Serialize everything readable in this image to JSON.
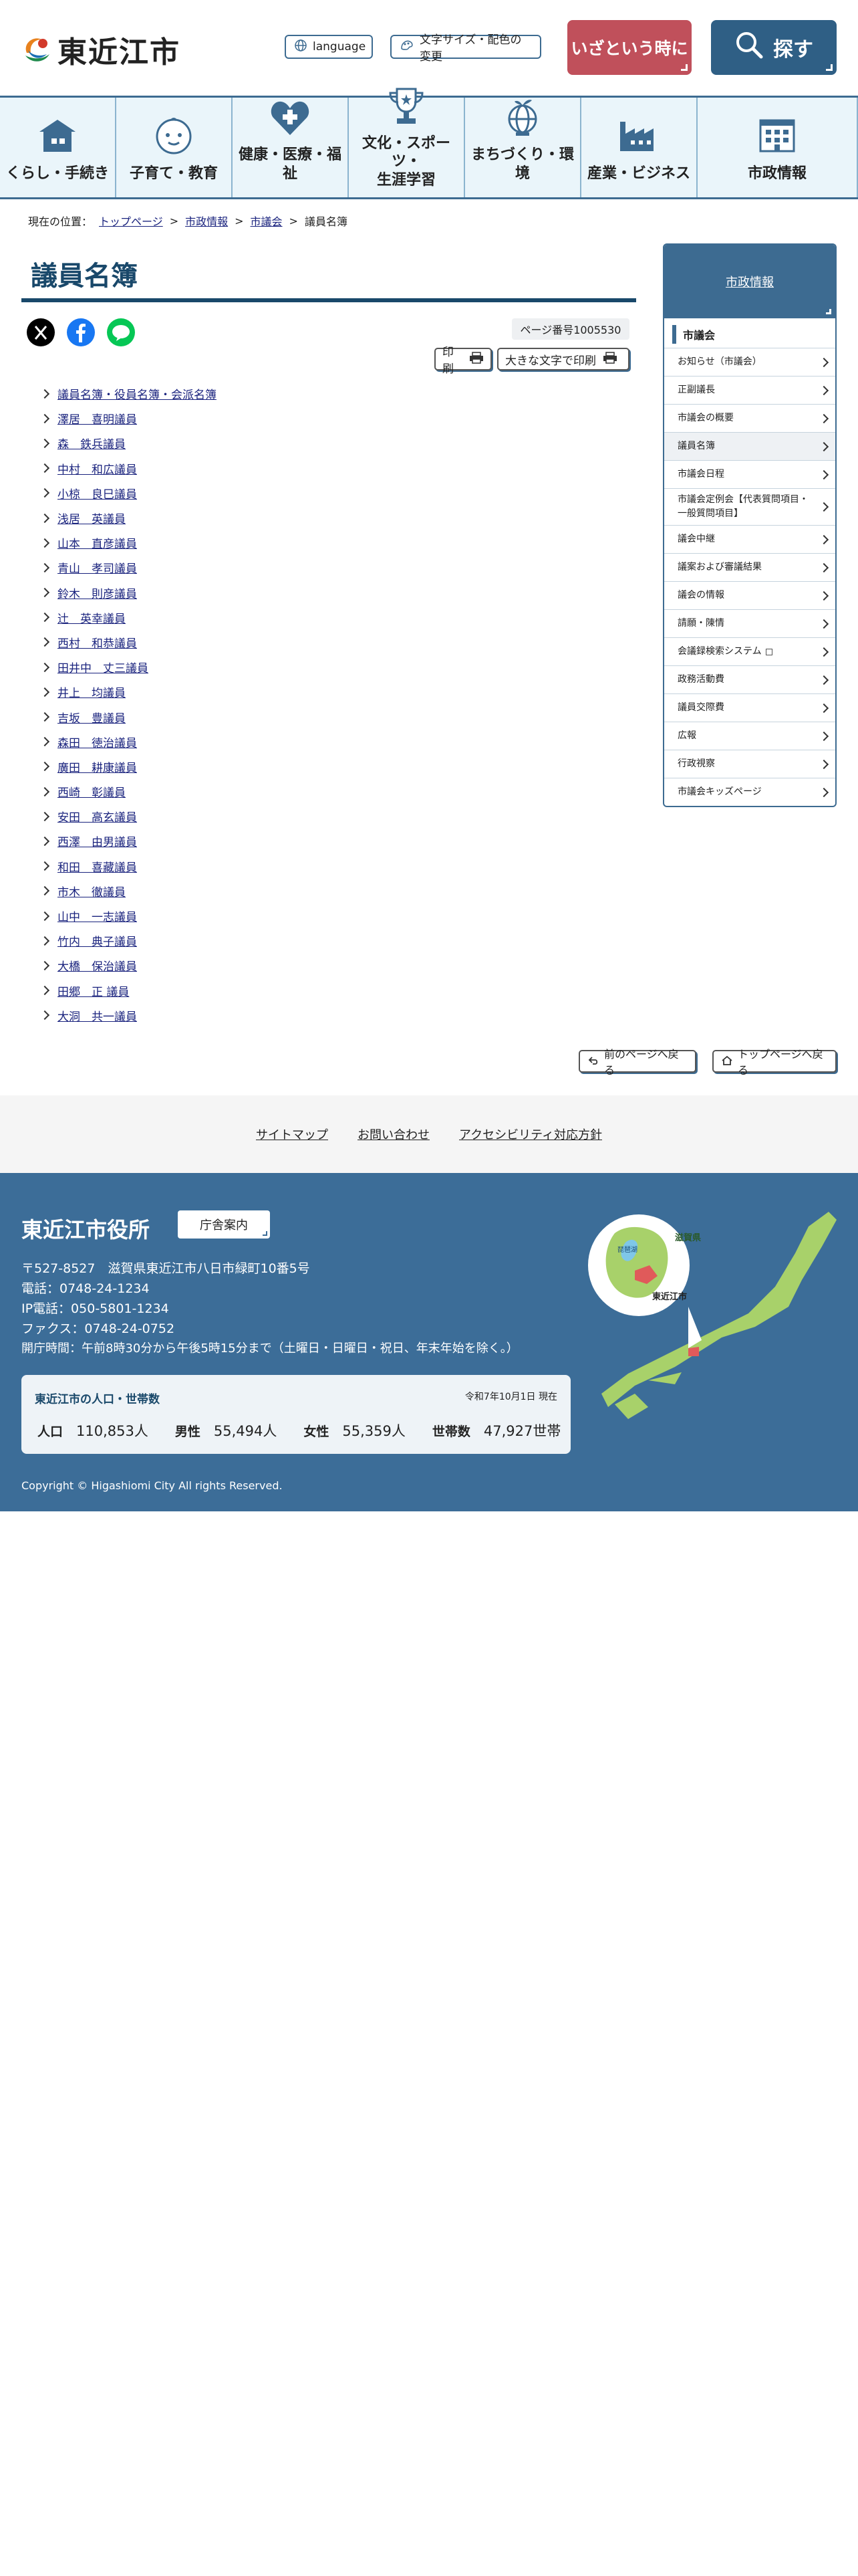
{
  "site": {
    "logo_text": "東近江市"
  },
  "header": {
    "language_label": "language",
    "fontsize_label": "文字サイズ・配色の変更",
    "emergency_label": "いざという時に",
    "search_label": "探す"
  },
  "gnav": [
    {
      "label": "くらし・手続き",
      "icon": "house-icon"
    },
    {
      "label": "子育て・教育",
      "icon": "baby-icon"
    },
    {
      "label": "健康・医療・福祉",
      "icon": "heart-icon"
    },
    {
      "label": "文化・スポーツ・\n生涯学習",
      "icon": "trophy-icon"
    },
    {
      "label": "まちづくり・環境",
      "icon": "globe-icon"
    },
    {
      "label": "産業・ビジネス",
      "icon": "factory-icon"
    },
    {
      "label": "市政情報",
      "icon": "building-icon"
    }
  ],
  "breadcrumb": {
    "prefix": "現在の位置：",
    "items": [
      "トップページ",
      "市政情報",
      "市議会"
    ],
    "current": "議員名簿",
    "sep": ">"
  },
  "page": {
    "title": "議員名簿",
    "page_number": "ページ番号1005530",
    "print_label": "印刷",
    "print_large_label": "大きな文字で印刷"
  },
  "members": [
    "議員名簿・役員名簿・会派名簿",
    "澤居　喜明議員",
    "森　鉄兵議員",
    "中村　和広議員",
    "小椋　良巳議員",
    "浅居　英議員",
    "山本　直彦議員",
    "青山　孝司議員",
    "鈴木　則彦議員",
    "辻　英幸議員",
    "西村　和恭議員",
    "田井中　丈三議員",
    "井上　均議員",
    "吉坂　豊議員",
    "森田　徳治議員",
    "廣田　耕康議員",
    "西崎　彰議員",
    "安田　高玄議員",
    "西澤　由男議員",
    "和田　喜藏議員",
    "市木　徹議員",
    "山中　一志議員",
    "竹内　典子議員",
    "大橋　保治議員",
    "田郷　正 議員",
    "大洞　共一議員"
  ],
  "sidebar": {
    "head": "市政情報",
    "sub": "市議会",
    "items": [
      {
        "label": "お知らせ（市議会）",
        "ext": false
      },
      {
        "label": "正副議長",
        "ext": false
      },
      {
        "label": "市議会の概要",
        "ext": false
      },
      {
        "label": "議員名簿",
        "ext": false,
        "active": true
      },
      {
        "label": "市議会日程",
        "ext": false
      },
      {
        "label": "市議会定例会【代表質問項目・一般質問項目】",
        "ext": false
      },
      {
        "label": "議会中継",
        "ext": false
      },
      {
        "label": "議案および審議結果",
        "ext": false
      },
      {
        "label": "議会の情報",
        "ext": false
      },
      {
        "label": "請願・陳情",
        "ext": false
      },
      {
        "label": "会議録検索システム",
        "ext": true
      },
      {
        "label": "政務活動費",
        "ext": false
      },
      {
        "label": "議員交際費",
        "ext": false
      },
      {
        "label": "広報",
        "ext": false
      },
      {
        "label": "行政視察",
        "ext": false
      },
      {
        "label": "市議会キッズページ",
        "ext": false
      }
    ]
  },
  "page_nav": {
    "back": "前のページへ戻る",
    "top": "トップページへ戻る"
  },
  "footer_links": [
    "サイトマップ",
    "お問い合わせ",
    "アクセシビリティ対応方針"
  ],
  "footer": {
    "title": "東近江市役所",
    "guide_btn": "庁舎案内",
    "address": "〒527-8527　滋賀県東近江市八日市緑町10番5号",
    "tel": "電話：0748-24-1234",
    "ip_tel": "IP電話：050-5801-1234",
    "fax": "ファクス：0748-24-0752",
    "hours": "開庁時間：午前8時30分から午後5時15分まで（土曜日・日曜日・祝日、年末年始を除く。）",
    "map": {
      "pref": "滋賀県",
      "lake": "琵琶湖",
      "city": "東近江市"
    },
    "population": {
      "title": "東近江市の人口・世帯数",
      "date": "令和7年10月1日 現在",
      "pop_label": "人口",
      "pop_value": "110,853人",
      "male_label": "男性",
      "male_value": "55,494人",
      "female_label": "女性",
      "female_value": "55,359人",
      "house_label": "世帯数",
      "house_value": "47,927世帯"
    },
    "copyright": "Copyright © Higashiomi City All rights Reserved."
  },
  "colors": {
    "primary": "#3d6b91",
    "title": "#19486a",
    "emergency": "#c0505b",
    "search": "#2f5f85",
    "footer": "#3c6d98"
  }
}
